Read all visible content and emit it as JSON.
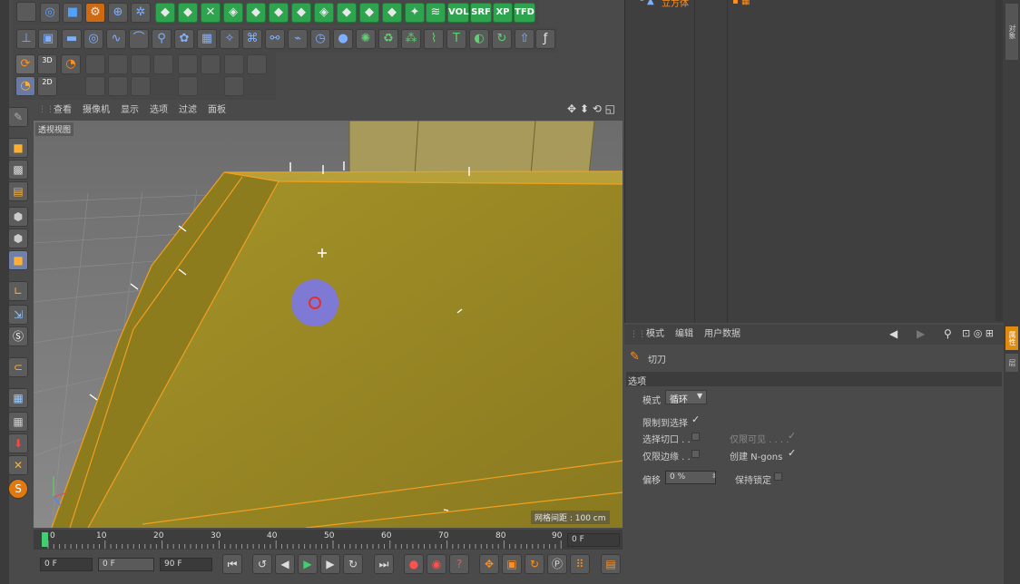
{
  "toolbar": {
    "row1_labels": [
      "VOL",
      "SRF",
      "XP",
      "TFD"
    ],
    "row3_labels": [
      "3D",
      "2D"
    ]
  },
  "viewport": {
    "menu": [
      "查看",
      "摄像机",
      "显示",
      "选项",
      "过滤",
      "面板"
    ],
    "view_name": "透视视图",
    "grid_spacing": "网格间距 : 100 cm"
  },
  "objects": {
    "item_label": "立方体"
  },
  "timeline": {
    "ticks": [
      "0",
      "10",
      "20",
      "30",
      "40",
      "50",
      "60",
      "70",
      "80",
      "90"
    ],
    "current_frame": "0 F",
    "start_field": "0 F",
    "min_field": "0 F",
    "end_field": "90 F"
  },
  "attributes": {
    "menu": [
      "模式",
      "编辑",
      "用户数据"
    ],
    "tool_name": "切刀",
    "section": "选项",
    "mode_label": "模式",
    "mode_value": "循环",
    "restrict_label": "限制到选择",
    "restrict_checked": true,
    "select_cuts_label": "选择切口 . .",
    "visible_only_label": "仅限可见 . . . .",
    "border_only_label": "仅限边缘 . .",
    "create_ngons_label": "创建 N-gons",
    "offset_label": "偏移",
    "offset_value": "0 %",
    "keep_lock_label": "保持锁定"
  },
  "right_tabs": [
    "对象",
    "属性",
    "层"
  ],
  "colors": {
    "ui_bg": "#4a4a4a",
    "panel_bg": "#3d3d3d",
    "accent_green": "#2ea44f",
    "mesh_yellow": "#b8a22c",
    "edge_orange": "#f0a020",
    "cursor_blue": "#7b78e8"
  }
}
